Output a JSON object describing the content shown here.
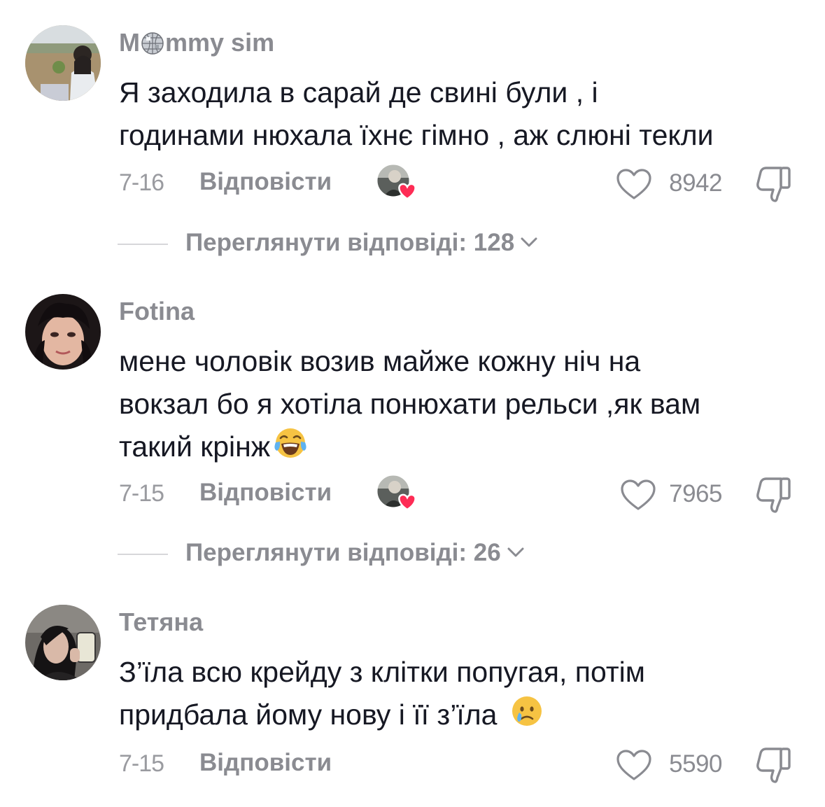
{
  "comments": [
    {
      "username_prefix": "M",
      "username_suffix": "mmy sim",
      "username_icon": "disco-ball-icon",
      "text_lines": [
        "Я заходила в сарай де свині були , і",
        "годинами нюхала їхнє гімно , аж слюні текли"
      ],
      "date": "7-16",
      "reply_label": "Відповісти",
      "creator_liked": true,
      "likes": "8942",
      "view_replies_label": "Переглянути відповіді: 128"
    },
    {
      "username": "Fotina",
      "text_lines": [
        "мене чоловік возив майже кожну ніч на",
        "вокзал бо я хотіла понюхати рельси ,як вам",
        "такий крінж"
      ],
      "trailing_emoji": "face-with-tears-of-joy",
      "date": "7-15",
      "reply_label": "Відповісти",
      "creator_liked": true,
      "likes": "7965",
      "view_replies_label": "Переглянути відповіді: 26"
    },
    {
      "username": "Тетяна",
      "text_lines": [
        "З’їла всю крейду з клітки попугая, потім",
        "придбала йому нову і її з’їла"
      ],
      "trailing_emoji": "crying-face",
      "date": "7-15",
      "reply_label": "Відповісти",
      "creator_liked": false,
      "likes": "5590"
    }
  ],
  "colors": {
    "text_primary": "#161823",
    "text_secondary": "#8a8b91",
    "creator_heart": "#fe2c55",
    "divider": "#d7d7da"
  },
  "icons": {
    "like": "heart-outline-icon",
    "dislike": "thumbs-down-icon",
    "creator_like_badge": "creator-liked-heart-icon",
    "expand": "chevron-down-icon"
  }
}
